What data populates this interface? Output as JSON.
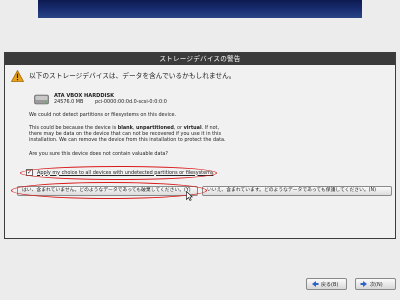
{
  "dialog": {
    "title": "ストレージデバイスの警告",
    "headline": "以下のストレージデバイスは、データを含んでいるかもしれません。",
    "disk": {
      "name": "ATA VBOX HARDDISK",
      "size": "24576.0 MB",
      "path": "pci-0000:00:0d.0-scsi-0:0:0:0"
    },
    "message_1": "We could not detect partitions or filesystems on this device.",
    "message_2_a": "This could be because the device is ",
    "message_2_blank": "blank",
    "message_2_b": ", ",
    "message_2_unpartitioned": "unpartitioned",
    "message_2_c": ", or ",
    "message_2_virtual": "virtual",
    "message_2_d": ". If not,",
    "message_2_line2": "there may be data on the device that can not be recovered if you use it in this",
    "message_2_line3": "installation. We can remove the device from this installation to protect the data.",
    "question": "Are you sure this device does not contain valuable data?",
    "checkbox_label": "Apply my choice to all devices with undetected partitions or filesystems",
    "checkbox_checked": true,
    "btn_no_data": "はい、含まれていません。どのようなデータであっても破棄してください。(Y)",
    "btn_has_data": "いいえ、含まれています。どのようなデータであっても保護してください。(N)"
  },
  "nav": {
    "back_label": "戻る(B)",
    "next_label": "次(N)"
  },
  "colors": {
    "banner": "#1b3175",
    "title_bar": "#3a3a3a",
    "annotation": "#d91a1a",
    "warning": "#e8a21a"
  }
}
